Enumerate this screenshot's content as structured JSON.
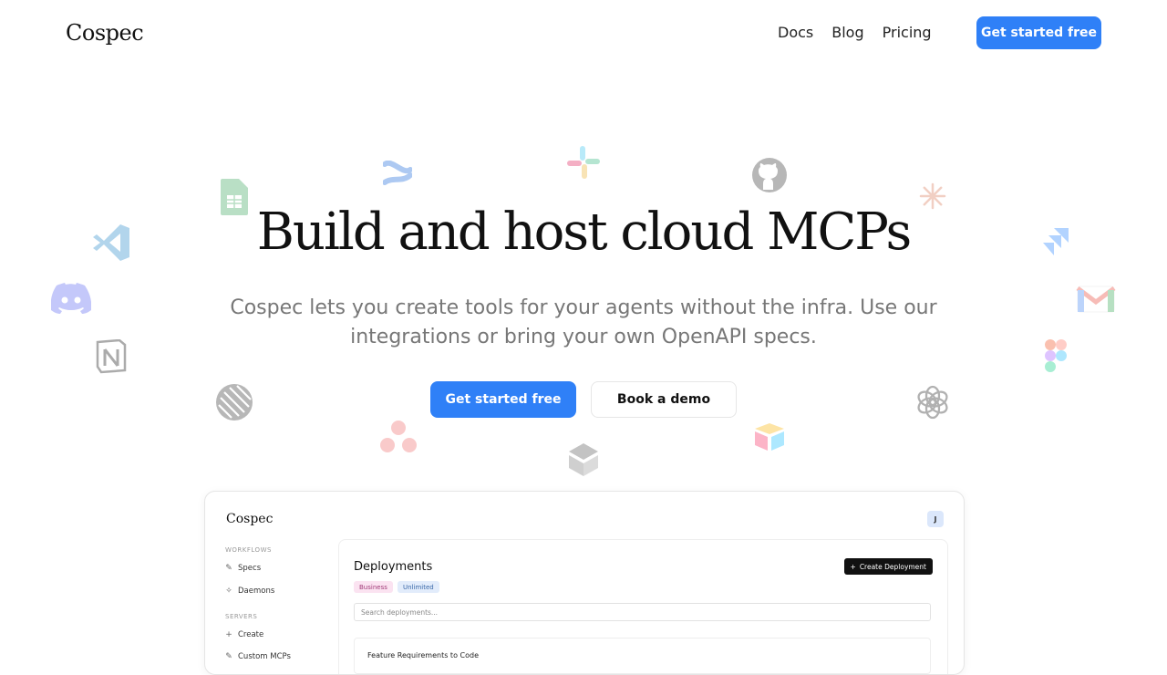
{
  "nav": {
    "logo": "Cospec",
    "links": [
      "Docs",
      "Blog",
      "Pricing"
    ],
    "cta": "Get started free"
  },
  "hero": {
    "title": "Build and host cloud MCPs",
    "subtitle": "Cospec lets you create tools for your agents without the infra. Use our integrations or bring your own OpenAPI specs.",
    "primary_button": "Get started free",
    "secondary_button": "Book a demo"
  },
  "floating_icons": [
    "google-sheets-icon",
    "confluence-icon",
    "slack-icon",
    "github-icon",
    "claude-icon",
    "vscode-icon",
    "jira-icon",
    "discord-icon",
    "gmail-icon",
    "notion-icon",
    "figma-icon",
    "linear-icon",
    "openai-icon",
    "asana-icon",
    "zendesk-icon",
    "airtable-icon"
  ],
  "preview": {
    "logo": "Cospec",
    "avatar": "J",
    "sidebar": {
      "workflows_label": "WORKFLOWS",
      "workflow_items": [
        "Specs",
        "Daemons"
      ],
      "servers_label": "SERVERS",
      "server_items": [
        "Create",
        "Custom MCPs"
      ]
    },
    "main": {
      "title": "Deployments",
      "badges": [
        "Business",
        "Unlimited"
      ],
      "create_button": "Create Deployment",
      "search_placeholder": "Search deployments...",
      "row_title": "Feature Requirements to Code"
    }
  },
  "colors": {
    "accent": "#2f80f7",
    "badge_business_bg": "#fbe3f1",
    "badge_unlimited_bg": "#e2ecfb"
  }
}
